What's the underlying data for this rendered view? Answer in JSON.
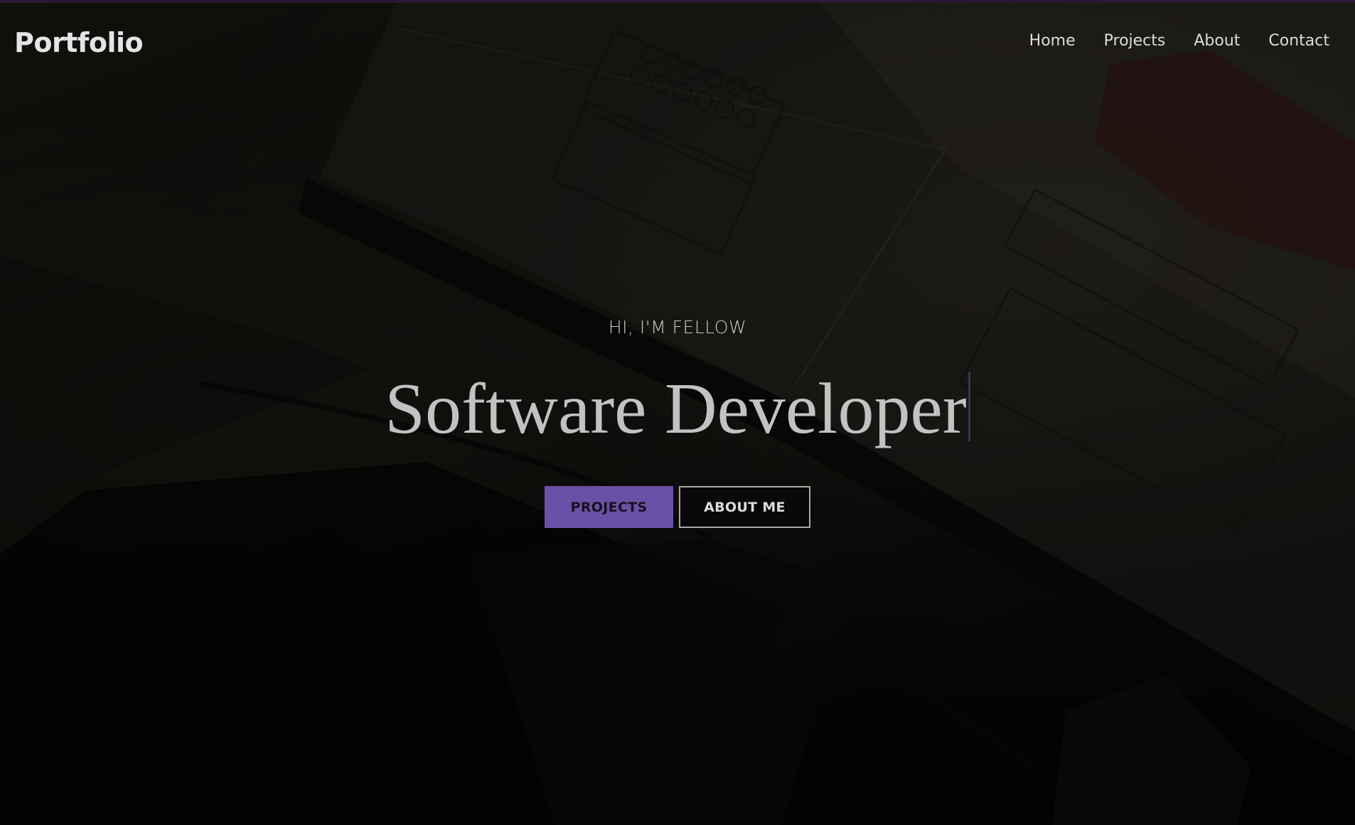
{
  "brand": "Portfolio",
  "nav": {
    "items": [
      {
        "label": "Home"
      },
      {
        "label": "Projects"
      },
      {
        "label": "About"
      },
      {
        "label": "Contact"
      }
    ]
  },
  "hero": {
    "greeting": "HI, I'M FELLOW",
    "title": "Software Developer",
    "primary_button": "PROJECTS",
    "secondary_button": "ABOUT ME"
  },
  "colors": {
    "accent": "#6b50a7",
    "background": "#050506",
    "text": "#c2c2c2"
  }
}
